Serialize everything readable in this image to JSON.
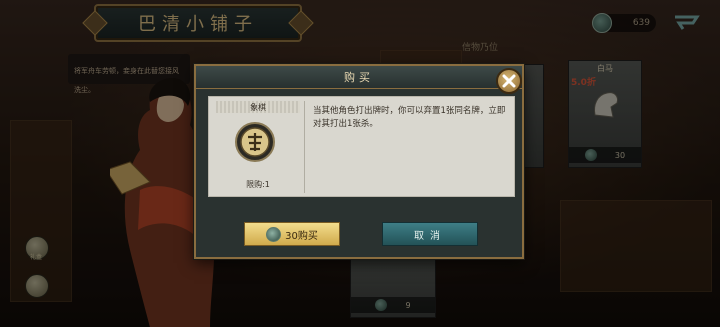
{
  "shop": {
    "title": "巴清小铺子",
    "currency_amount": "639",
    "section_title": "信物乃位",
    "npc_dialogue": "将军舟车劳顿，妾身在此替您接风洗尘。"
  },
  "cards": [
    {
      "name": "白马",
      "discount": "5.0折",
      "price": "30"
    },
    {
      "name": "",
      "discount": "",
      "price": "9"
    }
  ],
  "side_buttons": [
    {
      "label": "礼盒"
    },
    {
      "label": ""
    }
  ],
  "modal": {
    "title": "购买",
    "item_name": "象棋",
    "limit": "限购:1",
    "description": "当其他角色打出牌时，你可以弃置1张同名牌，立即对其打出1张杀。",
    "buy_label": "30购买",
    "cancel_label": "取消"
  },
  "colors": {
    "gold": "#d0aa4c",
    "teal": "#3e7e86",
    "frame": "#8a6d3f",
    "discount": "#e45a3c"
  },
  "icons": {
    "currency": "jade-coin-icon",
    "back": "back-arrow-icon",
    "close": "close-icon",
    "item": "xiangqi-piece-icon"
  }
}
